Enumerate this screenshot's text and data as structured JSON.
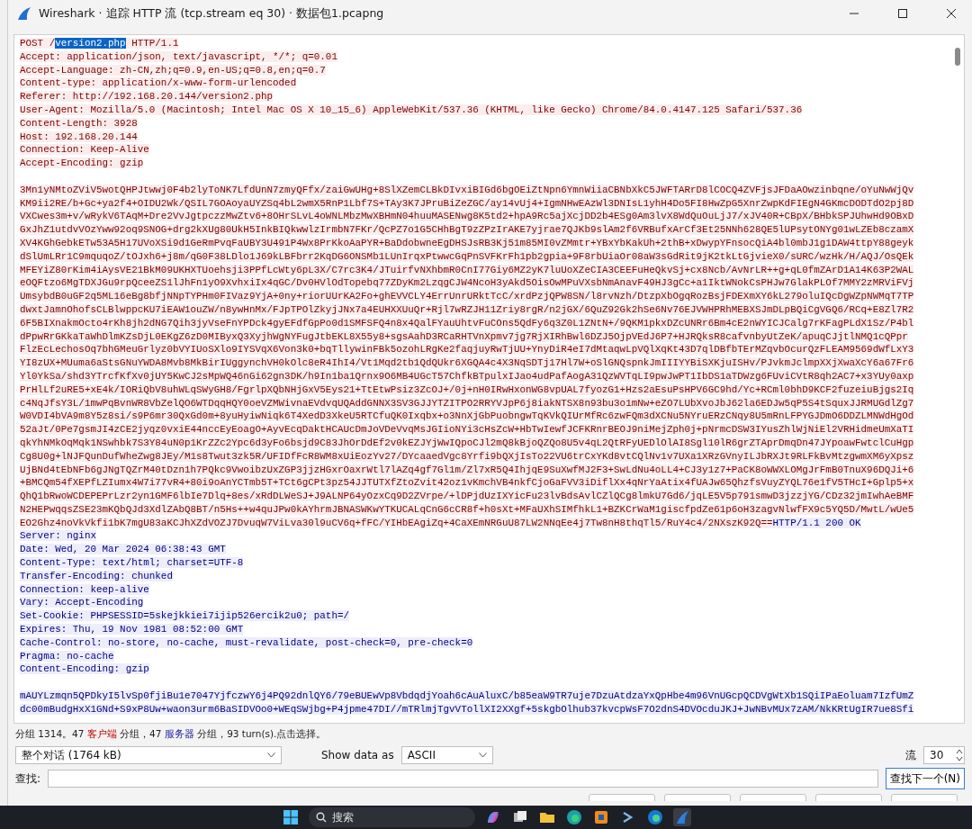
{
  "window": {
    "title": "Wireshark · 追踪 HTTP 流 (tcp.stream eq 30) · 数据包1.pcapng"
  },
  "stream": [
    {
      "kind": "client",
      "headers": [
        {
          "parts": [
            {
              "text": "POST /",
              "selected": false
            },
            {
              "text": "version2.php",
              "selected": true
            },
            {
              "text": " HTTP/1.1",
              "selected": false
            }
          ]
        },
        "Accept: application/json, text/javascript, */*; q=0.01",
        "Accept-Language: zh-CN,zh;q=0.9,en-US;q=0.8,en;q=0.7",
        "Content-type: application/x-www-form-urlencoded",
        "Referer: http://192.168.20.144/version2.php",
        "User-Agent: Mozilla/5.0 (Macintosh; Intel Mac OS X 10_15_6) AppleWebKit/537.36 (KHTML, like Gecko) Chrome/84.0.4147.125 Safari/537.36",
        "Content-Length: 3928",
        "Host: 192.168.20.144",
        "Connection: Keep-Alive",
        "Accept-Encoding: gzip"
      ],
      "body": [
        "3Mn1yNMtoZViV5wotQHPJtwwj0F4b2lyToNK7LfdUnN7zmyQFfx/zaiGwUHg+8SlXZemCLBkDIvxiBIGd6bgOEiZtNpn6YmnWiiaCBNbXkC5JWFTARrD8lCOCQ4ZVFjsJFDaAOwzinbqne/oYuNwWjQv",
        "KM9ii2RE/b+Gc+ya2f4+OIDU2Wk/QSIL7GOAoyaUYZSq4bL2wmX5RnP1Lbf7S+TAy3K7JPruBiZeZGC/ay14vUj4+IgmNHwEAzWl3DNIsL1yhH4Do5FI8HwZpG5XnrZwpKdFIEgN4GKmcDODTdO2pj8D",
        "VXCwes3m+v/wRykV6TAqM+Dre2VvJgtpczzMwZtv6+8OHrSLvL4oWNLMbzMwXBHmN04huuMASENwg8K5td2+hpA9Rc5ajXcjDD2b4ESg0Am3lvX8WdQuOuLjJ7/xJV40R+CBpX/BHbkSPJUhwHd9OBxD",
        "GxJhZ1utdvVOzYww92oq9SNOG+drg2kXUg80UkH5InkBIQkwwlzIrmbN7FKr/QcPZ7o1G5CHhBgT9zZPzIrAKE7yjrae7QJKb9slAm2f6VRBufxArCf3Et25NNh628QE5lUPsytONYg01wLZEb8czamX",
        "XV4KGhGebkETw53A5H17UVoXSi9d1GeRmPvqFaUBY3U491P4Wx8PrKkoAaPYR+BaDdobwneEgDHSJsRB3Kj51m85MI0vZMmtr+YBxYbKakUh+2thB+xDwypYFnsocQiA4bl0mbJ1g1DAW4ttpY88geyk",
        "dSlUmLRr1C9mquqoZ/tOJxh6+j8m/qG0F38LDlo1J69kLBFbrr2KqDG6ONSMb1LUnIrqxPtwwcGqPnSVFKrFh1pb2gpia+9F8rbUiaOr08aW3sGdRit9jK2tkLtGjvieX0/sURC/wzHk/H/AQJ/OsQEk",
        "MFEYiZ80rKim4iAysVE21BkM09UKHXTUoehsji3PPfLcWty6pL3X/C7rc3K4/JTuirfvNXhbmR0CnI77Giy6MZ2yK7luUoXZeCIA3CEEFuHeQkvSj+cx8Ncb/AvNrLR++g+qL0fmZArD1A14K63P2WAL",
        "eOQFtzo6MgTDXJGu9rpQceeZS1lJhFn1yO9XvhxiIx4qGC/Dv0HVlOdTopebq77ZDyKm2LzqgCJW4NcoH3yAkd5OisOwMPuVXsbNmAnavF49HJ3gCc+a1IktWNokCsPHJw7GlakPLOf7MMY2zMRViFVj",
        "UmsybdB0uGF2q5ML16eBg8bfjNNpTYPHm0FIVaz9YjA+0ny+riorUUrKA2Fo+ghEVVCLY4ErrUnrURktTcC/xrdPzjQPW8SN/l8rvNzh/DtzpXbOgqRozBsjFDEXmXY6kL279oluIQcDgWZpNWMqT7TP",
        "dwxtJamnOhofsCLBlwppcKU7iEAW1ouZW/n8ywHnMx/FJpTPOlZkyjJNx7a4EUHXXUuQr+Rjl7wRZJH11Zriy8rgR/n2jGX/6QuZ92Gk2hSe6Nv76EJVWHPRhMEBXSJmDLpBQiCgVGQ6/RCq+E8Zl7R2",
        "6F5BIXnakmOcto4rKh8jh2dNG7Qih3jyVseFnYPDck4gyEFdfGpPo0d1SMFSFQ4n8x4QalFYauUhtvFuCOns5QdFy6q3Z0L1ZNtN+/9QKM1pkxDZcUNRr6Bm4cE2nWYICJCalg7rKFagPLdX1Sz/P4bl",
        "dPpwRrGKkaTaWhDlmKZsDjL0EKgZ6zD0MIByxQ3XyjhWgNYFugJtbEKL8X55y8+sgsAahD3RCaRHTVnXpmv7jg7RjXIRhBwl6DZJ5OjpVEdJ6P7+HJRQksR8cafvnbyUtZeK/apuqCJjtlNMQ1cQPpr",
        "FlzEcLechosOq7bhGMeuGrlyz0bVYIUoSXlo9IYSVqX6Von3k0+bqTllywinFBk5ozohLRgKe2faqjuyRwTjUU+YnyDiR4eI7dMtaqwLpVQlXqKt43D7qlDBfbTErMZqvbOcurQzFLEAM9569dWfLxY3",
        "YI8zUX+MUuma6aStsGNuYWDA8Mvb8MkBirIUggynchVH0kOlc8eR4IhI4/Vt1Mqd2tb1QdQUkr6XGQA4c4X3NqSDTj17Hl7W+oSlGNQspnkJmIIIYYBiSXKjuISHv/PJvkmJclmpXXjXwaXcY6a67Fr6",
        "Yl0YkSa/shd3YTrcfKfXv0jUY5KwCJ2sMpWQ46nGi62gn3DK/h9In1ba1Qrnx9O6MB4UGcT57ChfkBTpulxIJao4udPafAogA31QzWVTqLI9pwJwPT1IbDS1aTDWzg6FUviCVtR8qh2AC7+x3YUy0axp",
        "PrHlLf2uRE5+xE4k/IORiQbV8uhWLqSWyGH8/FgrlpXQbNHjGxV5Eys21+TtEtwPsiz3ZcOJ+/0j+nH0IRwHxonWG8vpUAL7fyozG1+Hzs2aEsuPsHPV6GC9hd/Yc+RCml0bhD9KCF2fuzeiuBjgs2Iq",
        "c4NqJfsY3L/1mwPqBvnWR8VbZelQO6WTDqqHQY0oeVZMWivnaEVdvqUQAddGNNX3SV3GJJYTZITPO2RRYVJpP6j8iakNTSX8n93bu3o1mNw+eZO7LUbXvoJbJ62la6EDJw5qP5S4tSquxJJRMUGdlZg7",
        "W0VDI4bVA9m8Y5z8si/s9P6mr30QxGd0m+8yuHyiwNiqk6T4XedD3XkeU5RTCfuQK0Ixqbx+o3NnXjGbPuobngwTqKVkQIUrMfRc6zwFQm3dXCNu5NYruERzCNqy8U5mRnLFPYGJDmO6DDZLMNWdHgOd",
        "52aJt/0Pe7gsmJI4zCE2jyqz0vxiE44nccEyEoagO+AyvEcqDaktHCAUcDmJoVDeVvqMsJGIioNYi3cHsZcW+HbTwIewfJCFKRnrBEOJ9niMejZph0j+pNrmcDSW3IYusZhlWjNiEl2VRHidmeUmXaTI",
        "qkYhNMkOqMqk1NSwhbk7S3Y84uN0p1KrZZc2Ypc6d3yFo6bsjd9C83JhOrDdEf2v0kEZJYjWwIQpoCJl2mQ8kBjoQZQo8U5v4qL2QtRFyUEDlOlAI8Sgl10lR6grZTAprDmqDn47JYpoawFwtclCuHgp",
        "Cg8U0g+lNJFQunDufWheZwg8JEy/M1s8Twut3zk5R/UFIDfFcR8WM8xUiEozYv27/DYcaaedVgc8Yrfi9bQXjIsTo22VU6trCxYKd8vtCQlNv1v7UXa1XRzGVnyILJbRXJt9RLFkBvMtzgwmXM6yXpsz",
        "UjBNd4tEbNFb6gJNgTQZrM40tDzn1h7PQkc9VwoibzUxZGP3jjzHGxrOaxrWtl7lAZq4gf7Gl1m/Zl7xR5Q4IhjqE9SuXwfMJ2F3+SwLdNu4oLL4+CJ3y1z7+PaCK8oWWXLOMgJrFmB0TnuX96DQJi+6",
        "+BMCQm54fXEPfLZIumx4W7i77vR4+80i9oAnYCTmb5T+TCt6gCPt3pz54JJTUTXfZtoZvit42oz1vKmchVB4nkfCjoGaFVV3iDiflXx4qNrYaAtix4fUAJw65QhzfsVuyZYQL76e1fV5THcI+Gplp5+x",
        "QhQ1bRwoWCDEPEPrLzr2yn1GMF6lbIe7Dlq+8es/xRdDLWeSJ+J9ALNP64yOzxCq9D2ZVrpe/+lDPjdUzIXYicFu23lvBdsAvlCZlQCg8lmkU7Gd6/jqLE5V5p791smwD3jzzjYG/CDz32jmIwhAeBMF",
        "N2HEPwqqsZSE23mKQbQJd3XdlZAbQ8BT/n5Hs++w4quJPw0kAYhrmJBNASWKwYTKUCALqCnG6cCR8f+h0sXt+MFaUXhSIMfhkL1+BZKCrWaM1giscfpdZe61p6oH3zagvNlwfFX9c5YQ5D/MwtL/wUe5",
        "EO2Ghz4noVkVkfi1bK7mgU83aKCJhXZdVOZJ7DvuqW7ViLva30l9uCV6q+fFC/YIHbEAgiZq+4CaXEmNRGuU87LW2NNqEe4j7Tw8nH8thqTl5/RuY4c4/2NXszK92Q=="
      ]
    },
    {
      "kind": "server",
      "headers": [
        "HTTP/1.1 200 OK",
        "Server: nginx",
        "Date: Wed, 20 Mar 2024 06:38:43 GMT",
        "Content-Type: text/html; charset=UTF-8",
        "Transfer-Encoding: chunked",
        "Connection: keep-alive",
        "Vary: Accept-Encoding",
        "Set-Cookie: PHPSESSID=5skejkkiei7ijip526ercik2u0; path=/",
        "Expires: Thu, 19 Nov 1981 08:52:00 GMT",
        "Cache-Control: no-store, no-cache, must-revalidate, post-check=0, pre-check=0",
        "Pragma: no-cache",
        "Content-Encoding: gzip"
      ],
      "body": [
        "mAUYLzmqn5QPDkyI5lvSp0fjiBu1e7047YjfczwY6j4PQ92dnlQY6/79eBUEwVp8VbdqdjYoah6cAuAluxC/b85eaW9TR7uje7DzuAtdzaYxQpHbe4m96VnUGcpQCDVgWtXb1SQiIPaEoluam7IzfUmZ",
        "dc00mBudgHxX1GNd+S9xP8Uw+waon3urm6BaSIDVOo0+WEqSWjbg+P4jpme47DI//mTRlmjTgvVTollXI2XXgf+5skgbOlhub37kvcpWsF7O2dnS4DVOcduJKJ+JwNBvMUx7zAM/NkKRtUgIR7ue8Sfi"
      ]
    }
  ],
  "status": [
    {
      "text": "分组 1314。47 ",
      "kind": "plain"
    },
    {
      "text": "客户端",
      "kind": "client"
    },
    {
      "text": " 分组，47 ",
      "kind": "plain"
    },
    {
      "text": "服务器",
      "kind": "server"
    },
    {
      "text": " 分组，93 turn(s).点击选择。",
      "kind": "plain"
    }
  ],
  "conversation_select": {
    "value": "整个对话 (1764 kB)"
  },
  "show_data_as": {
    "label": "Show data as",
    "value": "ASCII"
  },
  "stream_number": {
    "label": "流",
    "value": "30"
  },
  "find": {
    "label": "查找:",
    "button": "查找下一个(N)"
  },
  "taskbar": {
    "search_placeholder": "搜索"
  }
}
